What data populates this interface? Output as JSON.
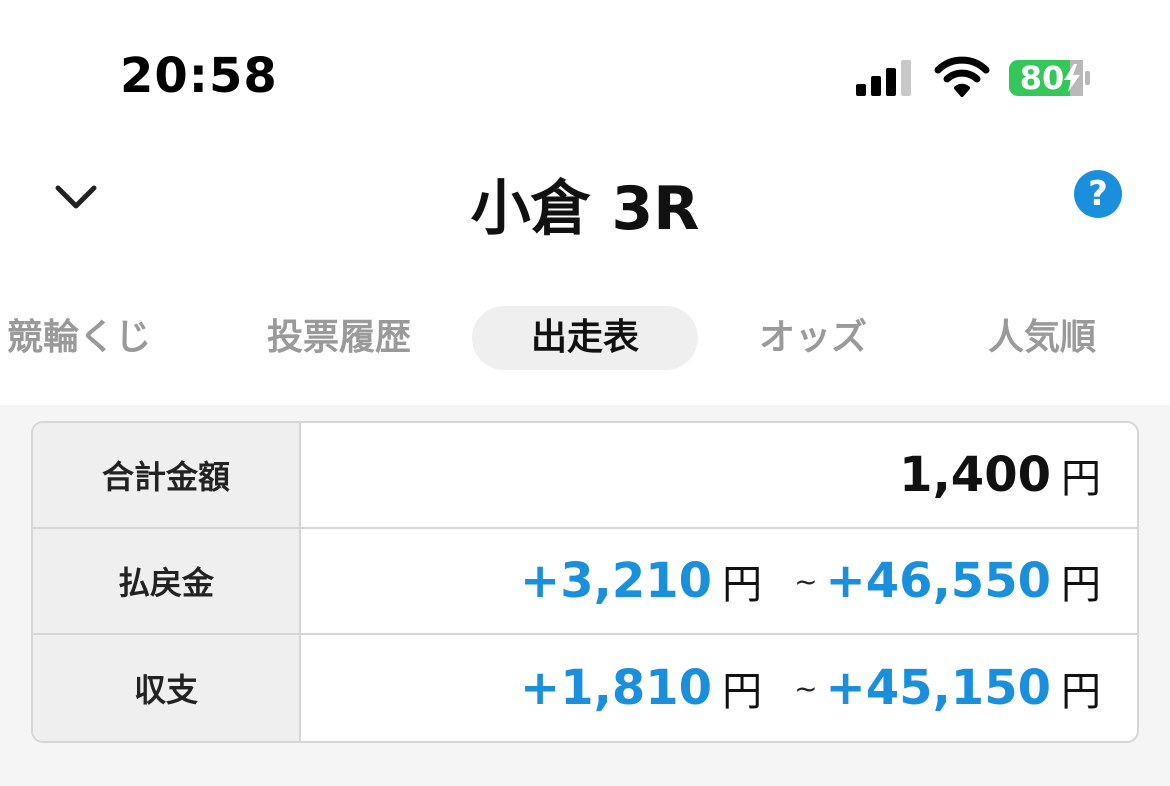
{
  "status_bar": {
    "time": "20:58",
    "battery": "80",
    "icons": [
      "cellular-signal-icon",
      "wifi-icon",
      "battery-charging-icon"
    ],
    "battery_color": "#34c759"
  },
  "header": {
    "back_icon": "chevron-down-icon",
    "title": "小倉 3R",
    "help_label": "?",
    "help_color": "#1a8fdc"
  },
  "tabs": [
    {
      "label": "競輪くじ",
      "active": false
    },
    {
      "label": "投票履歴",
      "active": false
    },
    {
      "label": "出走表",
      "active": true
    },
    {
      "label": "オッズ",
      "active": false
    },
    {
      "label": "人気順",
      "active": false
    }
  ],
  "summary": {
    "total": {
      "label": "合計金額",
      "value": "1,400",
      "unit": "円"
    },
    "payout": {
      "label": "払戻金",
      "min": "+3,210",
      "max": "+46,550",
      "unit": "円",
      "separator": "~"
    },
    "balance": {
      "label": "収支",
      "min": "+1,810",
      "max": "+45,150",
      "unit": "円",
      "separator": "~"
    },
    "accent_color": "#1a8fdc"
  }
}
